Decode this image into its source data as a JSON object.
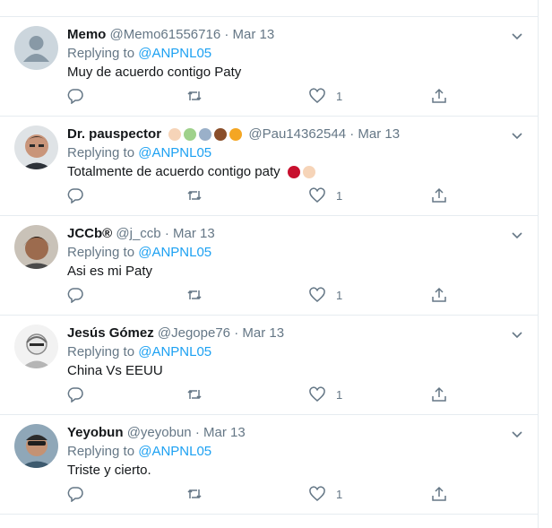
{
  "colors": {
    "link": "#1da1f2",
    "muted": "#657786",
    "text": "#14171a",
    "divider": "#e6ecf0"
  },
  "tweets": [
    {
      "name": "Memo",
      "handle": "@Memo61556716",
      "separator": "·",
      "date": "Mar 13",
      "replying_prefix": "Replying to ",
      "replying_to": "@ANPNL05",
      "text": "Muy de acuerdo contigo Paty",
      "like_count": "1",
      "avatar": "default-avatar-icon"
    },
    {
      "name": "Dr. pauspector",
      "name_emojis": [
        "folded-hands-emoji",
        "masks-emoji",
        "man-emoji",
        "coffee-emoji",
        "beer-emoji"
      ],
      "handle": "@Pau14362544",
      "separator": "·",
      "date": "Mar 13",
      "replying_prefix": "Replying to ",
      "replying_to": "@ANPNL05",
      "text": "Totalmente de acuerdo contigo paty",
      "text_emojis": [
        "rose-emoji",
        "thumbs-up-emoji"
      ],
      "like_count": "1",
      "avatar": "user-photo"
    },
    {
      "name": "JCCb®",
      "handle": "@j_ccb",
      "separator": "·",
      "date": "Mar 13",
      "replying_prefix": "Replying to ",
      "replying_to": "@ANPNL05",
      "text": "Asi es mi Paty",
      "like_count": "1",
      "avatar": "user-photo"
    },
    {
      "name": "Jesús Gómez",
      "handle": "@Jegope76",
      "separator": "·",
      "date": "Mar 13",
      "replying_prefix": "Replying to ",
      "replying_to": "@ANPNL05",
      "text": "China Vs EEUU",
      "like_count": "1",
      "avatar": "user-photo"
    },
    {
      "name": "Yeyobun",
      "handle": "@yeyobun",
      "separator": "·",
      "date": "Mar 13",
      "replying_prefix": "Replying to ",
      "replying_to": "@ANPNL05",
      "text": "Triste y cierto.",
      "like_count": "1",
      "avatar": "user-photo"
    }
  ]
}
